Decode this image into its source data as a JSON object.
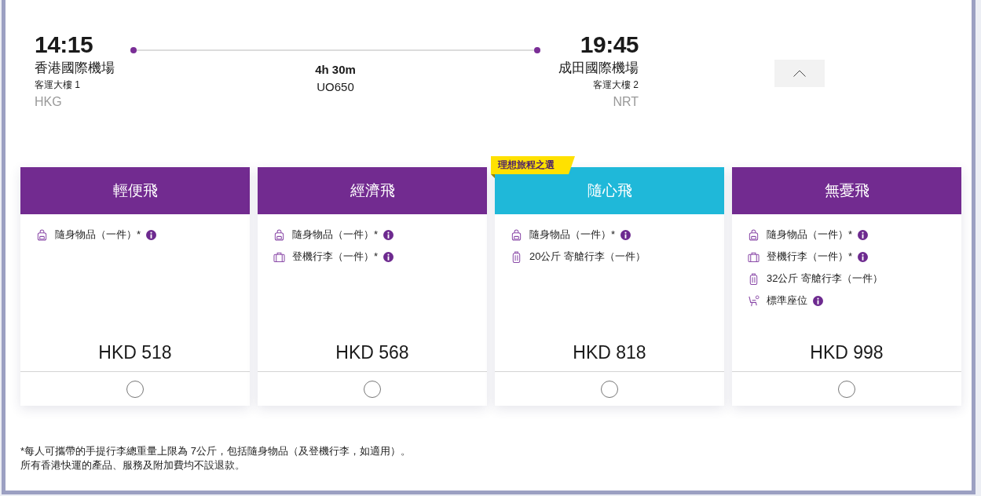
{
  "flight": {
    "departure": {
      "time": "14:15",
      "airport": "香港國際機場",
      "terminal": "客運大樓 1",
      "code": "HKG"
    },
    "duration": "4h 30m",
    "flight_number": "UO650",
    "arrival": {
      "time": "19:45",
      "airport": "成田國際機場",
      "terminal": "客運大樓 2",
      "code": "NRT"
    },
    "expanded": true
  },
  "fares": [
    {
      "name": "輕便飛",
      "color": "#722b90",
      "features": [
        {
          "kind": "backpack",
          "text": "隨身物品（一件）*",
          "info": true
        }
      ],
      "price": "HKD 518",
      "selected": false
    },
    {
      "name": "經濟飛",
      "color": "#722b90",
      "features": [
        {
          "kind": "backpack",
          "text": "隨身物品（一件）*",
          "info": true
        },
        {
          "kind": "cabin-bag",
          "text": "登機行李（一件）*",
          "info": true
        }
      ],
      "price": "HKD 568",
      "selected": false
    },
    {
      "name": "隨心飛",
      "color": "#1fb8d9",
      "badge": "理想旅程之選",
      "features": [
        {
          "kind": "backpack",
          "text": "隨身物品（一件）*",
          "info": true
        },
        {
          "kind": "suitcase",
          "text": "20公斤 寄艙行李（一件）",
          "info": false
        }
      ],
      "price": "HKD 818",
      "selected": false
    },
    {
      "name": "無憂飛",
      "color": "#722b90",
      "features": [
        {
          "kind": "backpack",
          "text": "隨身物品（一件）*",
          "info": true
        },
        {
          "kind": "cabin-bag",
          "text": "登機行李（一件）*",
          "info": true
        },
        {
          "kind": "suitcase",
          "text": "32公斤 寄艙行李（一件）",
          "info": false
        },
        {
          "kind": "seat",
          "text": "標準座位",
          "info": true
        }
      ],
      "price": "HKD 998",
      "selected": false
    }
  ],
  "notes": [
    "*每人可攜帶的手提行李總重量上限為 7公斤，包括隨身物品（及登機行李，如適用）。",
    "所有香港快運的產品、服務及附加費均不設退款。"
  ]
}
